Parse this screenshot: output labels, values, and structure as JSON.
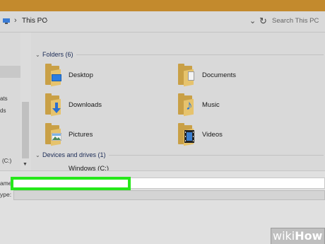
{
  "header": {
    "breadcrumb": "This PC",
    "search_placeholder": "Search This PC"
  },
  "colors": {
    "title_bar": "#c38a2d",
    "highlight": "#26e81a",
    "folder_yellow": "#e6c36d"
  },
  "nav_pane": {
    "fragments": [
      "ats",
      "ds",
      "(C:)"
    ]
  },
  "sections": {
    "folders": "Folders (6)",
    "devices": "Devices and drives (1)"
  },
  "folders": [
    {
      "name": "Desktop",
      "icon": "desktop-folder-icon"
    },
    {
      "name": "Documents",
      "icon": "documents-folder-icon"
    },
    {
      "name": "Downloads",
      "icon": "downloads-folder-icon"
    },
    {
      "name": "Music",
      "icon": "music-folder-icon"
    },
    {
      "name": "Pictures",
      "icon": "pictures-folder-icon"
    },
    {
      "name": "Videos",
      "icon": "videos-folder-icon"
    }
  ],
  "drives": [
    {
      "name": "Windows (C:)",
      "icon": "drive-icon"
    }
  ],
  "save_form": {
    "file_name_label": "ame:",
    "file_type_label": "ype:",
    "file_name_value": ""
  },
  "watermark": {
    "wiki": "wiki",
    "how": "How"
  }
}
